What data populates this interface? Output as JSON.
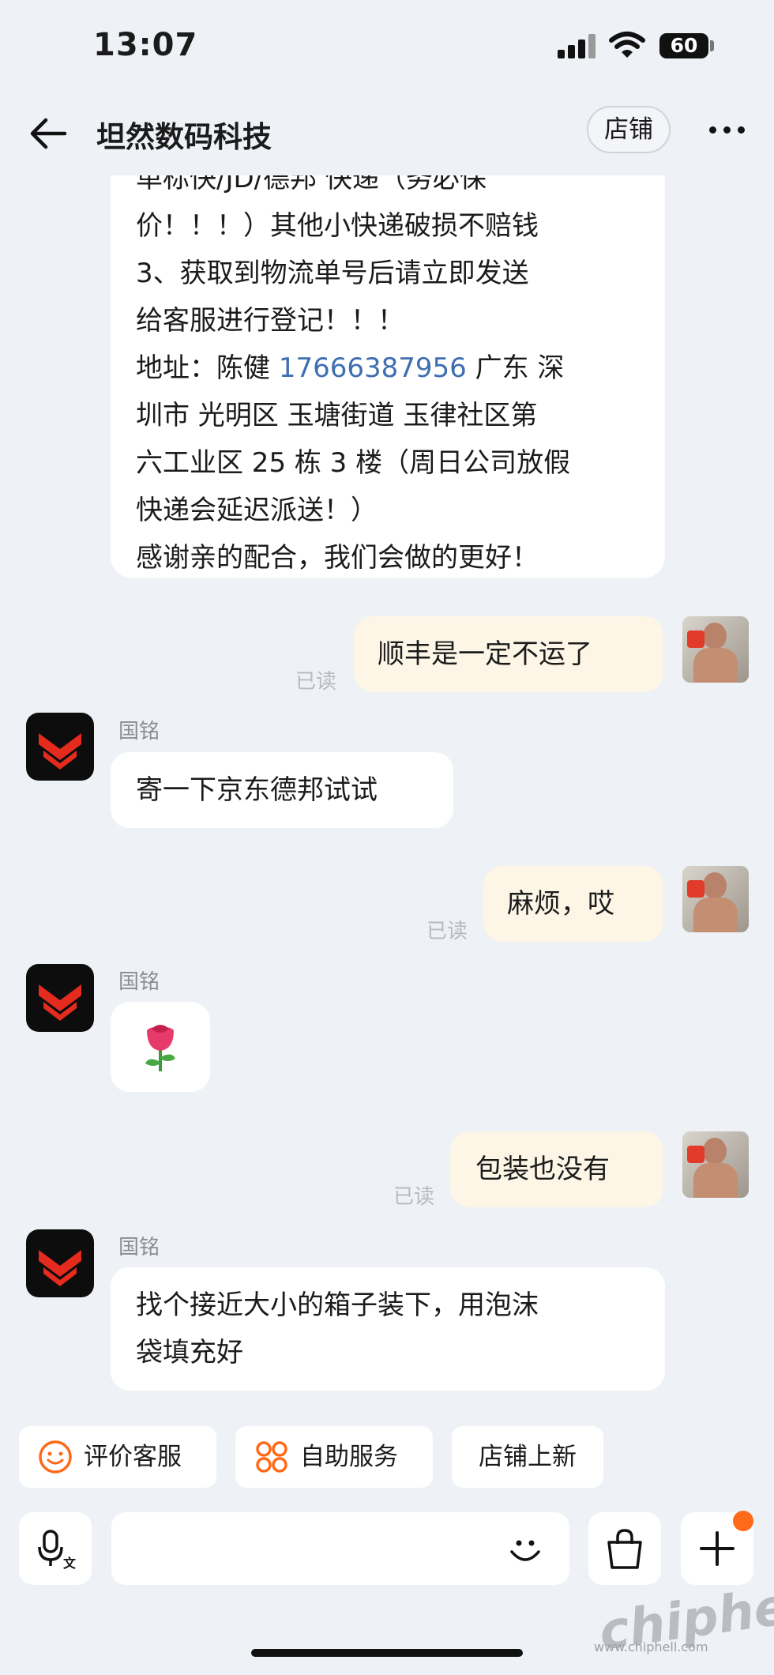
{
  "status_bar": {
    "time": "13:07",
    "battery": "60"
  },
  "header": {
    "title": "坦然数码科技",
    "shop_button": "店铺"
  },
  "messages": {
    "m1": {
      "lines": [
        "单标快/JD/德邦 快递（务必保",
        "价！！！）其他小快递破损不赔钱",
        "3、获取到物流单号后请立即发送",
        "给客服进行登记！！！"
      ],
      "address_label": "地址：陈健 ",
      "phone": "17666387956",
      "address_rest": " 广东 深",
      "address_lines": [
        "圳市 光明区 玉塘街道 玉律社区第",
        "六工业区 25 栋 3 楼（周日公司放假",
        "快递会延迟派送！）",
        "感谢亲的配合，我们会做的更好！"
      ]
    },
    "m2": {
      "text": "顺丰是一定不运了",
      "status": "已读"
    },
    "m3": {
      "sender": "国铭",
      "text": "寄一下京东德邦试试"
    },
    "m4": {
      "text": "麻烦，哎",
      "status": "已读"
    },
    "m5": {
      "sender": "国铭",
      "emoji": "🌹"
    },
    "m6": {
      "text": "包装也没有",
      "status": "已读"
    },
    "m7": {
      "sender": "国铭",
      "lines": [
        "找个接近大小的箱子装下，用泡沫",
        "袋填充好"
      ]
    }
  },
  "quick_actions": {
    "rate": "评价客服",
    "self_service": "自助服务",
    "new_items": "店铺上新"
  },
  "input": {
    "placeholder": ""
  },
  "watermark": {
    "logo": "chiphell",
    "url": "www.chiphell.com"
  },
  "colors": {
    "background": "#eef1f6",
    "my_bubble": "#fdf6e7",
    "link": "#3e6fb0",
    "accent": "#ff6a1a",
    "logo_red": "#e52a1e"
  }
}
